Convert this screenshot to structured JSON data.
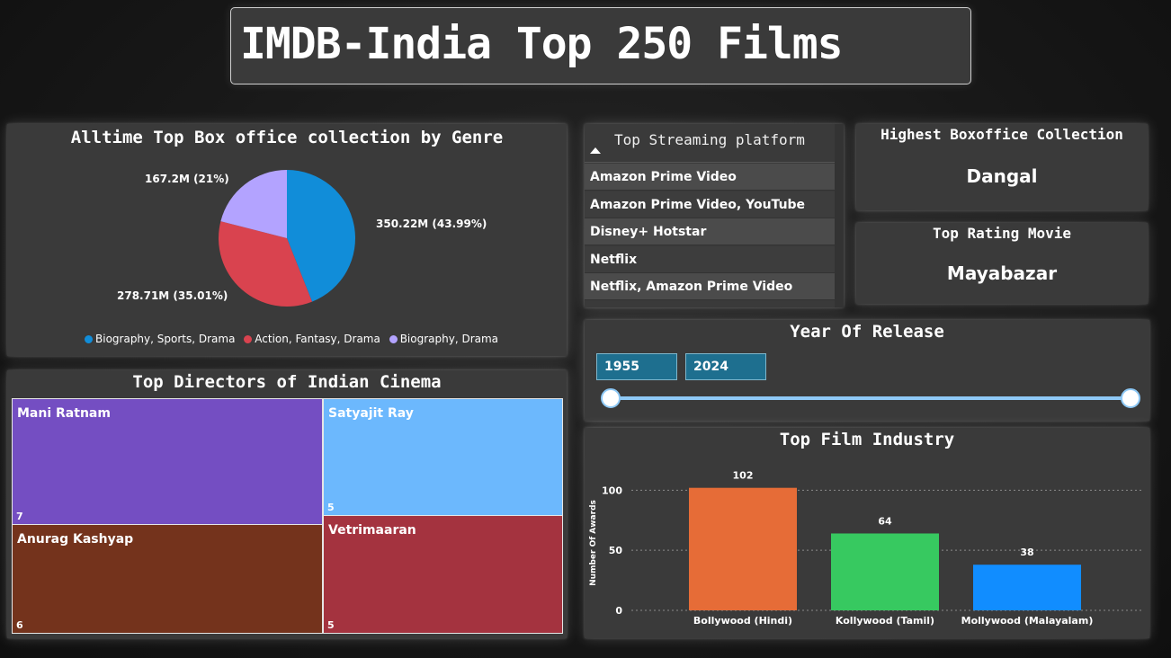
{
  "title": "IMDB-India Top 250 Films",
  "genre_pie": {
    "title": "Alltime Top Box office collection by Genre",
    "colors": [
      "#118dd9",
      "#d9434f",
      "#b3a3ff"
    ],
    "chart_data": {
      "type": "pie",
      "labels": [
        "Biography, Sports, Drama",
        "Action, Fantasy, Drama",
        "Biography, Drama"
      ],
      "values": [
        350.22,
        278.71,
        167.2
      ],
      "data_labels": [
        "350.22M (43.99%)",
        "278.71M (35.01%)",
        "167.2M (21%)"
      ],
      "legend": "bottom"
    }
  },
  "directors": {
    "title": "Top Directors of Indian Cinema",
    "tiles": [
      {
        "name": "Mani Ratnam",
        "value": "7",
        "color": "#744ec2"
      },
      {
        "name": "Satyajit Ray",
        "value": "5",
        "color": "#6cb8fd"
      },
      {
        "name": "Anurag Kashyap",
        "value": "6",
        "color": "#74331c"
      },
      {
        "name": "Vetrimaaran",
        "value": "5",
        "color": "#a4333f"
      }
    ]
  },
  "streaming": {
    "header": "Top Streaming platform",
    "items": [
      "Amazon Prime Video",
      "Amazon Prime Video, YouTube",
      "Disney+ Hotstar",
      "Netflix",
      "Netflix, Amazon Prime Video"
    ]
  },
  "card_boxoffice": {
    "title": "Highest Boxoffice Collection",
    "value": "Dangal"
  },
  "card_rating": {
    "title": "Top Rating Movie",
    "value": "Mayabazar"
  },
  "year_slider": {
    "title": "Year Of Release",
    "start": "1955",
    "end": "2024"
  },
  "industry_bar": {
    "title": "Top Film Industry",
    "colors": [
      "#e66c37",
      "#37c960",
      "#118dff"
    ],
    "chart_data": {
      "type": "bar",
      "categories": [
        "Bollywood (Hindi)",
        "Kollywood (Tamil)",
        "Mollywood (Malayalam)"
      ],
      "values": [
        102,
        64,
        38
      ],
      "ylabel": "Number Of Awards",
      "yticks": [
        "0",
        "50",
        "100"
      ],
      "ylim": [
        0,
        110
      ],
      "grid": true
    }
  }
}
